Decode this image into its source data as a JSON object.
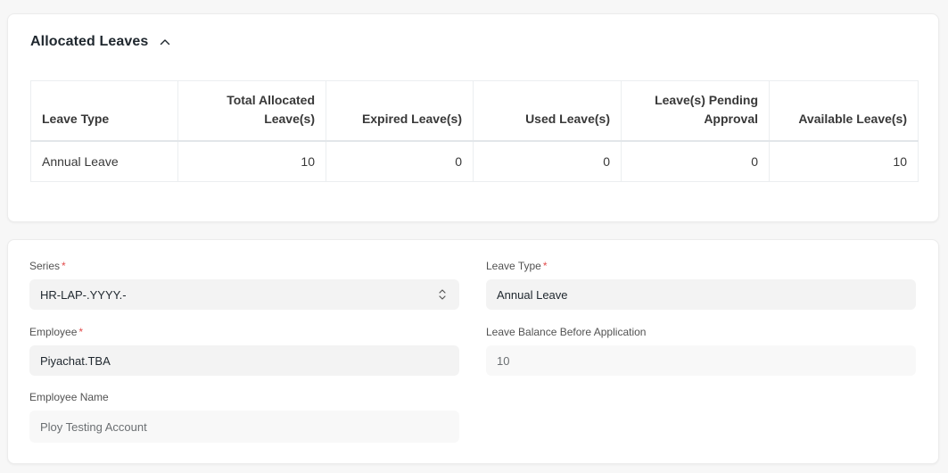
{
  "allocated": {
    "title": "Allocated Leaves",
    "headers": {
      "leave_type": "Leave Type",
      "total_allocated_1": "Total Allocated",
      "total_allocated_2": "Leave(s)",
      "expired": "Expired Leave(s)",
      "used": "Used Leave(s)",
      "pending_1": "Leave(s) Pending",
      "pending_2": "Approval",
      "available": "Available Leave(s)"
    },
    "rows": [
      {
        "leave_type": "Annual Leave",
        "total_allocated": "10",
        "expired": "0",
        "used": "0",
        "pending": "0",
        "available": "10"
      }
    ]
  },
  "form": {
    "series": {
      "label": "Series",
      "required": "*",
      "value": "HR-LAP-.YYYY.-"
    },
    "leave_type": {
      "label": "Leave Type",
      "required": "*",
      "value": "Annual Leave"
    },
    "employee": {
      "label": "Employee",
      "required": "*",
      "value": "Piyachat.TBA"
    },
    "leave_balance": {
      "label": "Leave Balance Before Application",
      "value": "10"
    },
    "employee_name": {
      "label": "Employee Name",
      "value": "Ploy Testing Account"
    }
  },
  "icons": {
    "collapse": "chevron-up-icon",
    "select": "select-arrows-icon"
  },
  "colors": {
    "required": "#e24c4c",
    "background": "#f7f7f7",
    "input": "#f3f3f3"
  }
}
